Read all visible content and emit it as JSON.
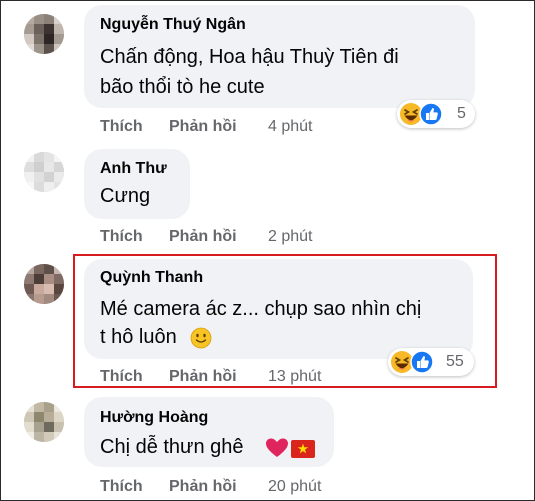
{
  "comments": [
    {
      "author": "Nguyễn Thuý Ngân",
      "lines": [
        "Chấn động, Hoa hậu Thuỳ Tiên đi",
        "bão thổi tò he cute"
      ],
      "like": "Thích",
      "reply": "Phản hồi",
      "time": "4 phút",
      "reaction_count": "5",
      "reactions": [
        "haha",
        "like"
      ]
    },
    {
      "author": "Anh Thư",
      "lines": [
        "Cưng"
      ],
      "like": "Thích",
      "reply": "Phản hồi",
      "time": "2 phút"
    },
    {
      "author": "Quỳnh Thanh",
      "lines": [
        "Mé camera ác z... chụp sao nhìn chị",
        "t hô luôn"
      ],
      "like": "Thích",
      "reply": "Phản hồi",
      "time": "13 phút",
      "reaction_count": "55",
      "reactions": [
        "haha",
        "like"
      ],
      "inline_emoji": "slightly-smiling-face",
      "highlighted": true
    },
    {
      "author": "Hường Hoàng",
      "lines": [
        "Chị dễ thưn ghê"
      ],
      "like": "Thích",
      "reply": "Phản hồi",
      "time": "20 phút",
      "inline_emoji": [
        "red-heart",
        "vietnam-flag"
      ]
    }
  ],
  "colors": {
    "bubble": "#f0f2f5",
    "secondary_text": "#65676b",
    "highlight_border": "#d81b21",
    "like_blue": "#1877f2",
    "haha_yellow": "#f7b928"
  }
}
